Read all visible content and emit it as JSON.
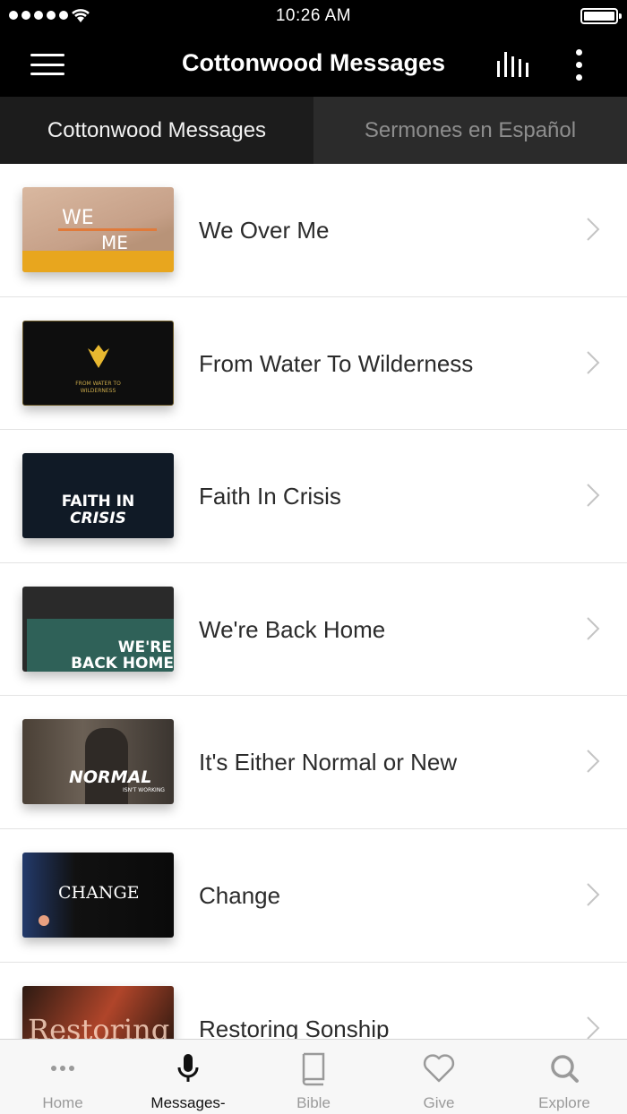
{
  "status_bar": {
    "time": "10:26 AM"
  },
  "header": {
    "title": "Cottonwood Messages"
  },
  "tabs": [
    {
      "label": "Cottonwood Messages",
      "active": true
    },
    {
      "label": "Sermones en Español",
      "active": false
    }
  ],
  "messages": [
    {
      "title": "We Over Me",
      "thumb_text": [
        "WE",
        "ME"
      ]
    },
    {
      "title": "From Water To Wilderness",
      "thumb_text": [
        "FROM WATER TO",
        "WILDERNESS"
      ]
    },
    {
      "title": "Faith In Crisis",
      "thumb_text": [
        "FAITH IN",
        "CRISIS"
      ]
    },
    {
      "title": "We're Back Home",
      "thumb_text": [
        "WE'RE",
        "BACK HOME"
      ]
    },
    {
      "title": "It's Either Normal or New",
      "thumb_text": [
        "NORMAL",
        "ISN'T WORKING"
      ]
    },
    {
      "title": "Change",
      "thumb_text": [
        "CHANGE"
      ]
    },
    {
      "title": "Restoring Sonship",
      "thumb_text": [
        "Restoring"
      ]
    }
  ],
  "bottom_nav": [
    {
      "label": "Home",
      "icon": "ellipsis-icon",
      "active": false
    },
    {
      "label": "Messages-",
      "icon": "microphone-icon",
      "active": true
    },
    {
      "label": "Bible",
      "icon": "book-icon",
      "active": false
    },
    {
      "label": "Give",
      "icon": "heart-icon",
      "active": false
    },
    {
      "label": "Explore",
      "icon": "search-icon",
      "active": false
    }
  ],
  "colors": {
    "bar": "#000000",
    "tab_active": "#1c1c1c",
    "tab_inactive": "#2b2b2b",
    "nav_active": "#111111",
    "nav_inactive": "#9a9a9a"
  }
}
